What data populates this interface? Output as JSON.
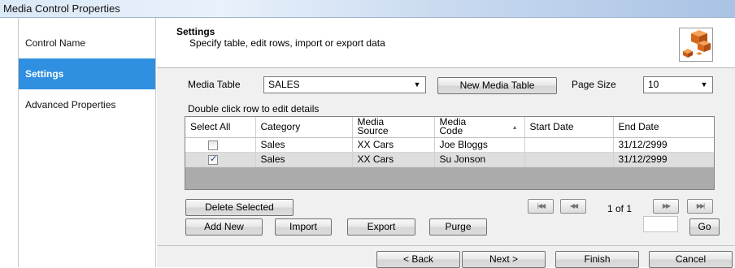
{
  "window": {
    "title": "Media Control Properties"
  },
  "sidebar": {
    "items": [
      {
        "label": "Control Name",
        "active": false
      },
      {
        "label": "Settings",
        "active": true
      },
      {
        "label": "Advanced Properties",
        "active": false
      }
    ]
  },
  "header": {
    "title": "Settings",
    "subtitle": "Specify table, edit rows, import or export data",
    "logo_icon": "cubes-icon"
  },
  "media_table": {
    "label": "Media Table",
    "value": "SALES"
  },
  "new_media_table_label": "New Media Table",
  "page_size": {
    "label": "Page Size",
    "value": "10"
  },
  "hint": "Double click row to edit details",
  "grid": {
    "columns": [
      "Select All",
      "Category",
      "Media\nSource",
      "Media\nCode",
      "Start Date",
      "End Date"
    ],
    "rows": [
      {
        "checked": false,
        "category": "Sales",
        "source": "XX Cars",
        "code": "Joe Bloggs",
        "start": "",
        "end": "31/12/2999"
      },
      {
        "checked": true,
        "category": "Sales",
        "source": "XX Cars",
        "code": "Su Jonson",
        "start": "",
        "end": "31/12/2999"
      }
    ]
  },
  "buttons": {
    "delete_selected": "Delete Selected",
    "add_new": "Add New",
    "import": "Import",
    "export": "Export",
    "purge": "Purge",
    "go": "Go"
  },
  "pager": {
    "status": "1 of 1"
  },
  "footer": {
    "back": "< Back",
    "next": "Next >",
    "finish": "Finish",
    "cancel": "Cancel"
  },
  "colors": {
    "accent": "#2f8fe0",
    "grid_empty": "#ababab"
  }
}
